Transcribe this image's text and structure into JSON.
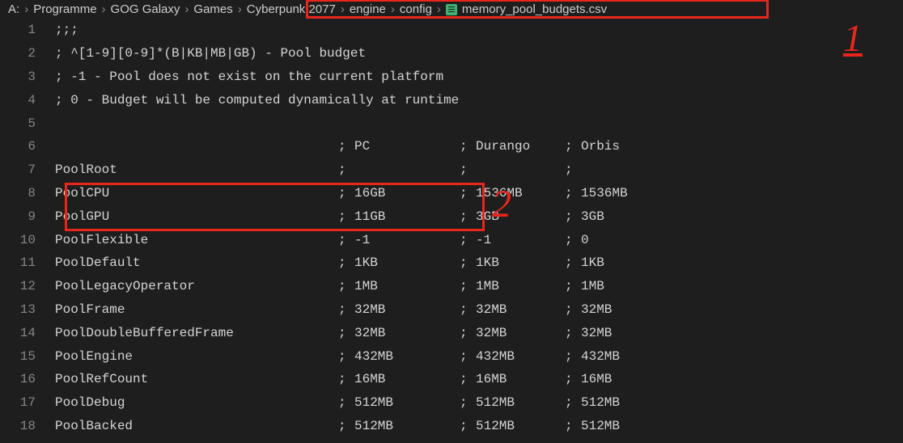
{
  "breadcrumb": {
    "items": [
      "A:",
      "Programme",
      "GOG Galaxy",
      "Games",
      "Cyberpunk 2077",
      "engine",
      "config"
    ],
    "filename": "memory_pool_budgets.csv"
  },
  "annotations": {
    "a1": "1",
    "a2": "2"
  },
  "lines": [
    {
      "num": "1",
      "type": "raw",
      "text": ";;;"
    },
    {
      "num": "2",
      "type": "raw",
      "text": "; ^[1-9][0-9]*(B|KB|MB|GB) - Pool budget"
    },
    {
      "num": "3",
      "type": "raw",
      "text": "; -1 - Pool does not exist on the current platform"
    },
    {
      "num": "4",
      "type": "raw",
      "text": "; 0 - Budget will be computed dynamically at runtime"
    },
    {
      "num": "5",
      "type": "raw",
      "text": ""
    },
    {
      "num": "6",
      "type": "row",
      "name": "",
      "pc": "PC",
      "dur": "Durango",
      "orb": "Orbis",
      "guides": true
    },
    {
      "num": "7",
      "type": "row",
      "name": "PoolRoot",
      "pc": "",
      "dur": "",
      "orb": ""
    },
    {
      "num": "8",
      "type": "row",
      "name": "PoolCPU",
      "pc": "16GB",
      "dur": "1536MB",
      "orb": "1536MB"
    },
    {
      "num": "9",
      "type": "row",
      "name": "PoolGPU",
      "pc": "11GB",
      "dur": "3GB",
      "orb": "3GB"
    },
    {
      "num": "10",
      "type": "row",
      "name": "PoolFlexible",
      "pc": "-1",
      "dur": "-1",
      "orb": "0"
    },
    {
      "num": "11",
      "type": "row",
      "name": "PoolDefault",
      "pc": "1KB",
      "dur": "1KB",
      "orb": "1KB"
    },
    {
      "num": "12",
      "type": "row",
      "name": "PoolLegacyOperator",
      "pc": "1MB",
      "dur": "1MB",
      "orb": "1MB"
    },
    {
      "num": "13",
      "type": "row",
      "name": "PoolFrame",
      "pc": "32MB",
      "dur": "32MB",
      "orb": "32MB"
    },
    {
      "num": "14",
      "type": "row",
      "name": "PoolDoubleBufferedFrame",
      "pc": "32MB",
      "dur": "32MB",
      "orb": "32MB"
    },
    {
      "num": "15",
      "type": "row",
      "name": "PoolEngine",
      "pc": "432MB",
      "dur": "432MB",
      "orb": "432MB"
    },
    {
      "num": "16",
      "type": "row",
      "name": "PoolRefCount",
      "pc": "16MB",
      "dur": "16MB",
      "orb": "16MB"
    },
    {
      "num": "17",
      "type": "row",
      "name": "PoolDebug",
      "pc": "512MB",
      "dur": "512MB",
      "orb": "512MB"
    },
    {
      "num": "18",
      "type": "row",
      "name": "PoolBacked",
      "pc": "512MB",
      "dur": "512MB",
      "orb": "512MB"
    }
  ],
  "sep": ";"
}
